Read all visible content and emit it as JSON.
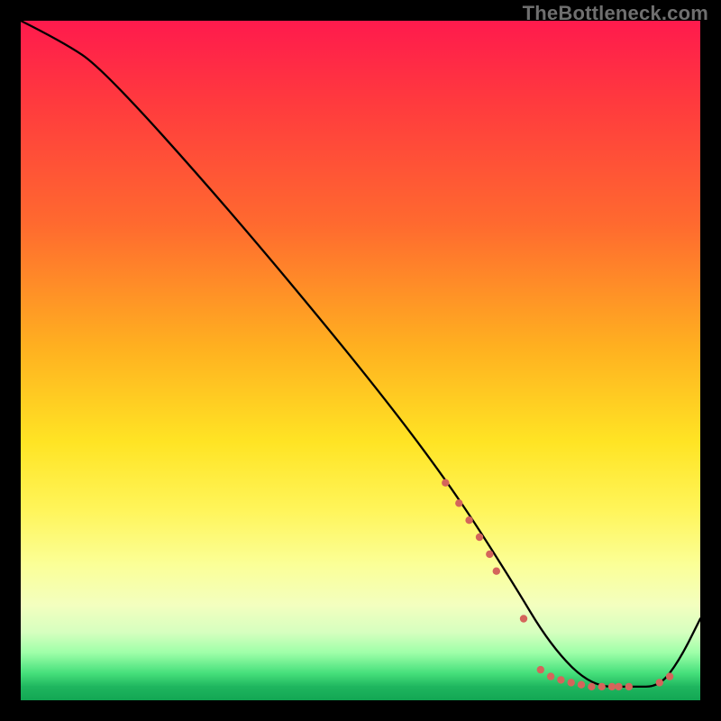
{
  "watermark": "TheBottleneck.com",
  "chart_data": {
    "type": "line",
    "title": "",
    "xlabel": "",
    "ylabel": "",
    "xlim": [
      0,
      100
    ],
    "ylim": [
      0,
      100
    ],
    "grid": false,
    "series": [
      {
        "name": "curve",
        "color": "#000000",
        "x": [
          0,
          6,
          12,
          30,
          50,
          63,
          72,
          78,
          84,
          90,
          94,
          97,
          100
        ],
        "y": [
          100,
          97,
          93,
          73,
          49,
          32,
          18,
          8,
          2,
          2,
          2,
          6,
          12
        ]
      }
    ],
    "markers": [
      {
        "x": 62.5,
        "y": 32,
        "r": 4.2
      },
      {
        "x": 64.5,
        "y": 29,
        "r": 4.2
      },
      {
        "x": 66.0,
        "y": 26.5,
        "r": 4.2
      },
      {
        "x": 67.5,
        "y": 24,
        "r": 4.2
      },
      {
        "x": 69.0,
        "y": 21.5,
        "r": 4.2
      },
      {
        "x": 70.0,
        "y": 19,
        "r": 4.2
      },
      {
        "x": 74.0,
        "y": 12,
        "r": 4.2
      },
      {
        "x": 76.5,
        "y": 4.5,
        "r": 4.2
      },
      {
        "x": 78.0,
        "y": 3.5,
        "r": 4.2
      },
      {
        "x": 79.5,
        "y": 3.0,
        "r": 4.2
      },
      {
        "x": 81.0,
        "y": 2.6,
        "r": 4.2
      },
      {
        "x": 82.5,
        "y": 2.3,
        "r": 4.2
      },
      {
        "x": 84.0,
        "y": 2.0,
        "r": 4.2
      },
      {
        "x": 85.5,
        "y": 2.0,
        "r": 4.2
      },
      {
        "x": 87.0,
        "y": 2.0,
        "r": 4.2
      },
      {
        "x": 88.0,
        "y": 2.0,
        "r": 4.2
      },
      {
        "x": 89.5,
        "y": 2.0,
        "r": 4.2
      },
      {
        "x": 94.0,
        "y": 2.6,
        "r": 4.2
      },
      {
        "x": 95.5,
        "y": 3.5,
        "r": 4.2
      }
    ],
    "marker_color": "#d4655b",
    "background_gradient": {
      "direction": "vertical",
      "stops": [
        {
          "pos": 0.0,
          "color": "#ff1a4d"
        },
        {
          "pos": 0.3,
          "color": "#ff6a2f"
        },
        {
          "pos": 0.62,
          "color": "#ffe424"
        },
        {
          "pos": 0.86,
          "color": "#f3ffbf"
        },
        {
          "pos": 0.96,
          "color": "#46e07b"
        },
        {
          "pos": 1.0,
          "color": "#12a653"
        }
      ]
    }
  }
}
